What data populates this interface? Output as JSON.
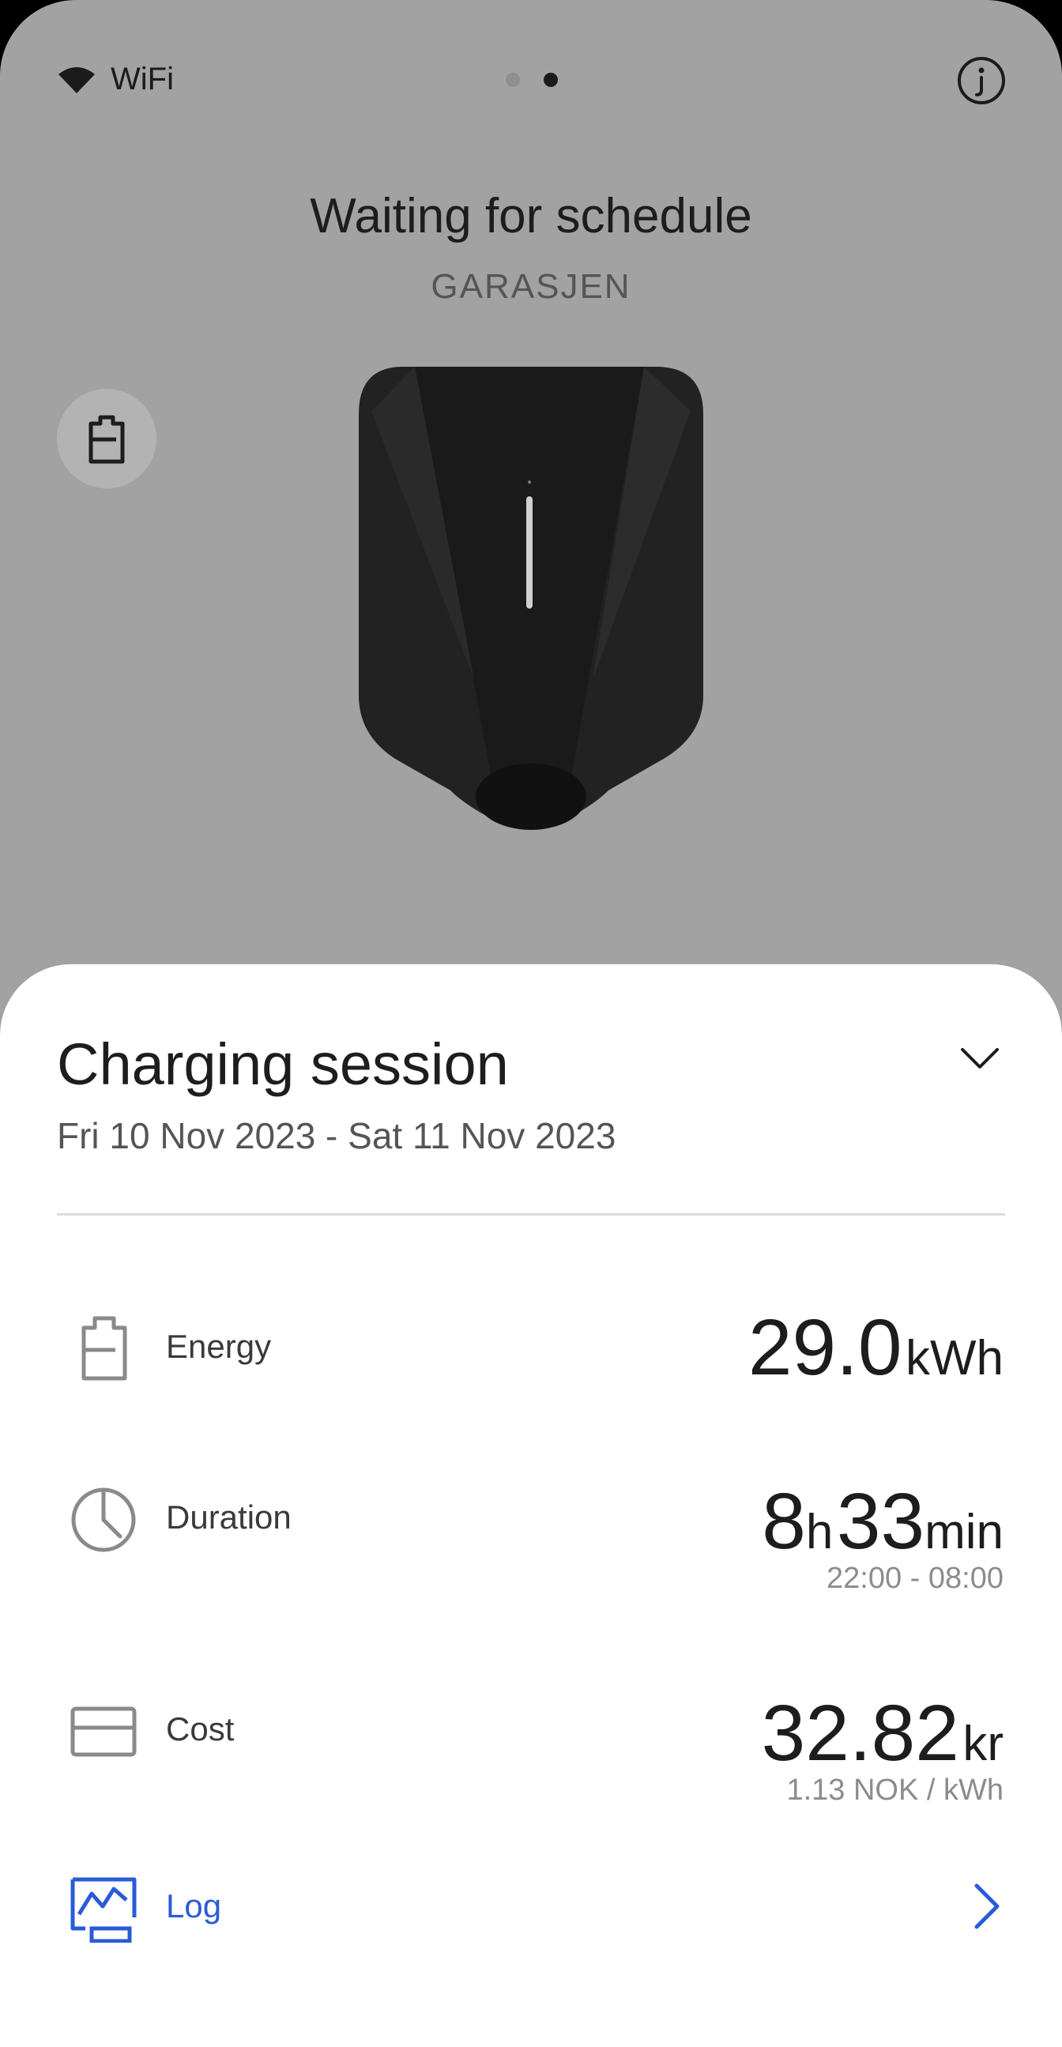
{
  "top_bar": {
    "wifi_label": "WiFi",
    "wifi_icon": "wifi-icon",
    "info_icon": "info-icon",
    "pager": {
      "count": 2,
      "active_index": 1
    }
  },
  "status": {
    "title": "Waiting for schedule",
    "device_name": "GARASJEN"
  },
  "side_button": {
    "icon": "battery-icon"
  },
  "charging_session": {
    "title": "Charging session",
    "date_range": "Fri 10 Nov 2023 - Sat 11 Nov 2023",
    "collapse_icon": "chevron-down-icon",
    "energy": {
      "label": "Energy",
      "value": "29.0",
      "unit": "kWh",
      "icon": "battery-icon"
    },
    "duration": {
      "label": "Duration",
      "hours": "8",
      "hours_unit": "h",
      "minutes": "33",
      "minutes_unit": "min",
      "time_range": "22:00 - 08:00",
      "icon": "clock-icon"
    },
    "cost": {
      "label": "Cost",
      "value": "32.82",
      "unit": "kr",
      "rate": "1.13 NOK / kWh",
      "icon": "card-icon"
    },
    "log": {
      "label": "Log",
      "icon": "chart-icon",
      "arrow_icon": "chevron-right-icon"
    }
  },
  "colors": {
    "background_dim": "#a2a2a2",
    "sheet": "#ffffff",
    "text_primary": "#1d1d1d",
    "text_secondary": "#555555",
    "accent": "#2a5bd7"
  }
}
